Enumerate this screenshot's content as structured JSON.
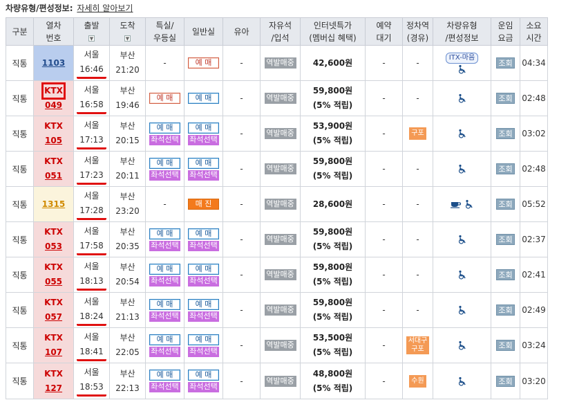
{
  "header": {
    "title": "차량유형/편성정보:",
    "link": "자세히 알아보기"
  },
  "columns": {
    "type": "구분",
    "train_no_1": "열차",
    "train_no_2": "번호",
    "dep": "출발",
    "arr": "도착",
    "first_1": "특실/",
    "first_2": "우등실",
    "general": "일반실",
    "infant": "유아",
    "free_1": "자유석",
    "free_2": "/입석",
    "net_1": "인터넷특가",
    "net_2": "(멤버십 혜택)",
    "reserve_1": "예약",
    "reserve_2": "대기",
    "stop_1": "정차역",
    "stop_2": "(경유)",
    "car_1": "차량유형",
    "car_2": "/편성정보",
    "fare_1": "운임",
    "fare_2": "요금",
    "dur_1": "소요",
    "dur_2": "시간",
    "sort_icon": "sort-down-icon"
  },
  "labels": {
    "book": "예 매",
    "standby": "매 진",
    "seat_select": "좌석선택",
    "station_sale": "역발매중",
    "lookup": "조회",
    "dash": "-",
    "itx_badge": "ITX-마음"
  },
  "rows": [
    {
      "kind": "직통",
      "train_type": "",
      "train_no": "1103",
      "dep_st": "서울",
      "dep_time": "16:46",
      "arr_st": "부산",
      "arr_time": "21:20",
      "first": "-",
      "general": "book-red",
      "infant": "-",
      "price": "42,600원",
      "points": "",
      "reserve": "-",
      "via": [],
      "car": [
        "itx-badge",
        "wheelchair-icon"
      ],
      "duration": "04:34"
    },
    {
      "kind": "직통",
      "train_type": "KTX",
      "train_no": "049",
      "dep_st": "서울",
      "dep_time": "16:58",
      "arr_st": "부산",
      "arr_time": "19:46",
      "first": "book-red",
      "general": "book",
      "infant": "-",
      "price": "59,800원",
      "points": "(5% 적립)",
      "reserve": "-",
      "via": [],
      "car": [
        "wheelchair-icon"
      ],
      "duration": "02:48"
    },
    {
      "kind": "직통",
      "train_type": "KTX",
      "train_no": "105",
      "dep_st": "서울",
      "dep_time": "17:13",
      "arr_st": "부산",
      "arr_time": "20:15",
      "first": "book-seat",
      "general": "book-seat",
      "infant": "-",
      "price": "53,900원",
      "points": "(5% 적립)",
      "reserve": "-",
      "via": [
        "구포"
      ],
      "car": [
        "wheelchair-icon"
      ],
      "duration": "03:02"
    },
    {
      "kind": "직통",
      "train_type": "KTX",
      "train_no": "051",
      "dep_st": "서울",
      "dep_time": "17:23",
      "arr_st": "부산",
      "arr_time": "20:11",
      "first": "book-seat",
      "general": "book-seat",
      "infant": "-",
      "price": "59,800원",
      "points": "(5% 적립)",
      "reserve": "-",
      "via": [],
      "car": [
        "wheelchair-icon"
      ],
      "duration": "02:48"
    },
    {
      "kind": "직통",
      "train_type": "",
      "train_no": "1315",
      "dep_st": "서울",
      "dep_time": "17:28",
      "arr_st": "부산",
      "arr_time": "23:20",
      "first": "-",
      "general": "standby",
      "infant": "-",
      "price": "28,600원",
      "points": "",
      "reserve": "-",
      "via": [],
      "car": [
        "cafe-icon",
        "wheelchair-icon"
      ],
      "duration": "05:52"
    },
    {
      "kind": "직통",
      "train_type": "KTX",
      "train_no": "053",
      "dep_st": "서울",
      "dep_time": "17:58",
      "arr_st": "부산",
      "arr_time": "20:35",
      "first": "book-seat",
      "general": "book-seat",
      "infant": "-",
      "price": "59,800원",
      "points": "(5% 적립)",
      "reserve": "-",
      "via": [],
      "car": [
        "wheelchair-icon"
      ],
      "duration": "02:37"
    },
    {
      "kind": "직통",
      "train_type": "KTX",
      "train_no": "055",
      "dep_st": "서울",
      "dep_time": "18:13",
      "arr_st": "부산",
      "arr_time": "20:54",
      "first": "book-seat",
      "general": "book-seat",
      "infant": "-",
      "price": "59,800원",
      "points": "(5% 적립)",
      "reserve": "-",
      "via": [],
      "car": [
        "wheelchair-icon"
      ],
      "duration": "02:41"
    },
    {
      "kind": "직통",
      "train_type": "KTX",
      "train_no": "057",
      "dep_st": "서울",
      "dep_time": "18:24",
      "arr_st": "부산",
      "arr_time": "21:13",
      "first": "book-seat",
      "general": "book-seat",
      "infant": "-",
      "price": "59,800원",
      "points": "(5% 적립)",
      "reserve": "-",
      "via": [],
      "car": [
        "wheelchair-icon"
      ],
      "duration": "02:49"
    },
    {
      "kind": "직통",
      "train_type": "KTX",
      "train_no": "107",
      "dep_st": "서울",
      "dep_time": "18:41",
      "arr_st": "부산",
      "arr_time": "22:05",
      "first": "book-seat",
      "general": "book-seat",
      "infant": "-",
      "price": "53,500원",
      "points": "(5% 적립)",
      "reserve": "-",
      "via": [
        "서대구",
        "구포"
      ],
      "car": [
        "wheelchair-icon"
      ],
      "duration": "03:24"
    },
    {
      "kind": "직통",
      "train_type": "KTX",
      "train_no": "127",
      "dep_st": "서울",
      "dep_time": "18:53",
      "arr_st": "부산",
      "arr_time": "22:13",
      "first": "book-seat",
      "general": "book-seat",
      "infant": "-",
      "price": "48,800원",
      "points": "(5% 적립)",
      "reserve": "-",
      "via": [
        "수원"
      ],
      "car": [
        "wheelchair-icon"
      ],
      "duration": "03:20"
    }
  ],
  "colors": {
    "ktx_bg": "#f6dada",
    "itx_bg": "#b9cdee",
    "mg_bg": "#fbf4dc",
    "highlight": "#e01010",
    "seat": "#c96de0",
    "via": "#f49a55",
    "standby": "#f37a1c"
  }
}
